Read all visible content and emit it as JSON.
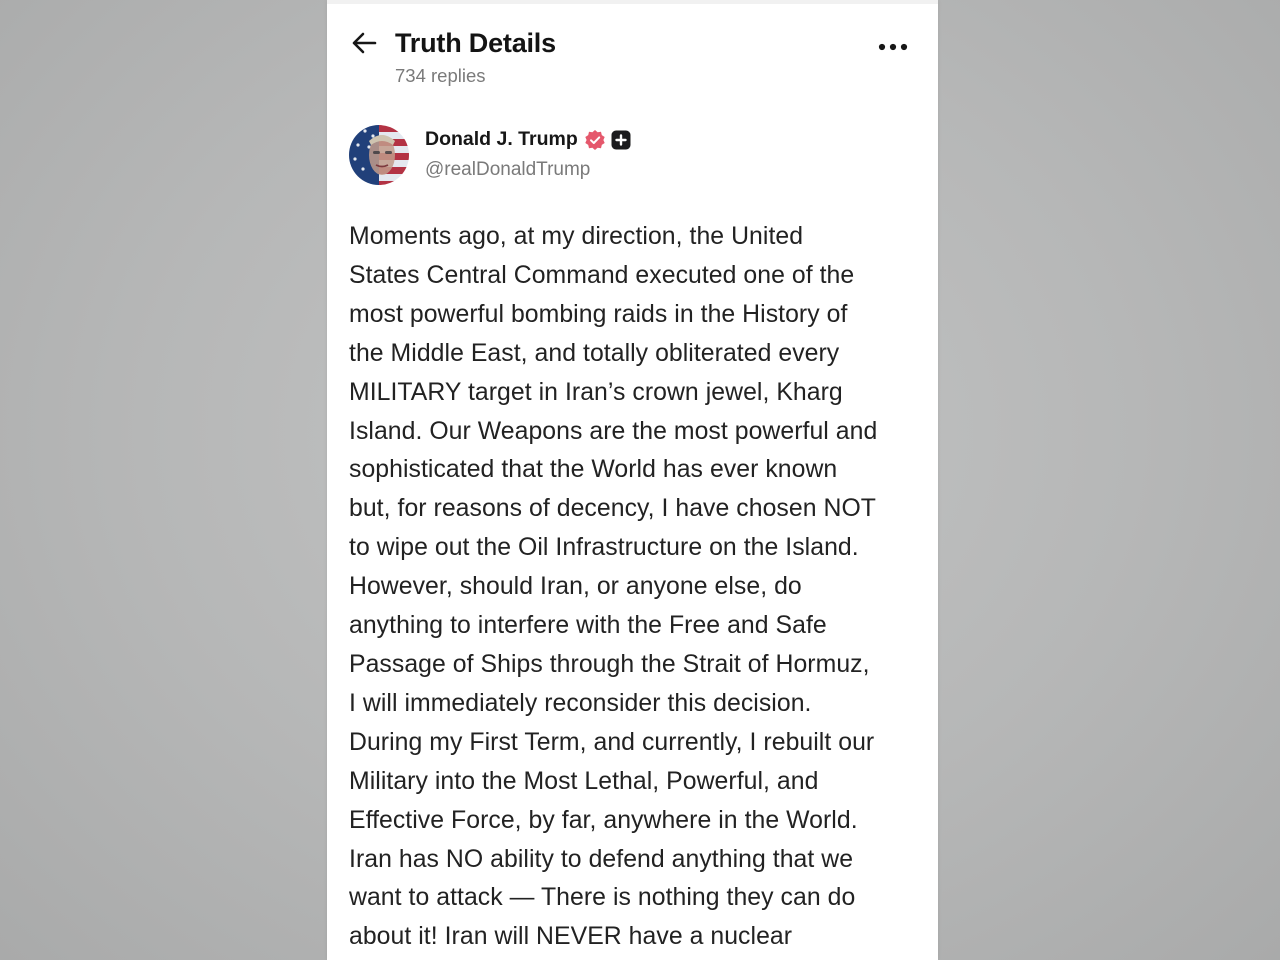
{
  "header": {
    "title": "Truth Details",
    "replies": "734 replies"
  },
  "author": {
    "name": "Donald J. Trump",
    "handle": "@realDonaldTrump",
    "avatar_icon": "flag-portrait-avatar",
    "verified_icon": "verified-badge-icon",
    "badge_icon": "plus-badge-icon",
    "verified_color": "#e5586c"
  },
  "post": {
    "lines": [
      "Moments ago, at my direction, the United",
      "States Central Command executed one of the",
      "most powerful bombing raids in the History of",
      "the Middle East, and totally obliterated every",
      "MILITARY target in Iran’s crown jewel, Kharg",
      "Island. Our Weapons are the most powerful and",
      "sophisticated that the World has ever known",
      "but, for reasons of decency, I have chosen NOT",
      "to wipe out the Oil Infrastructure on the Island.",
      "However, should Iran, or anyone else, do",
      "anything to interfere with the Free and Safe",
      "Passage of Ships through the Strait of Hormuz,",
      "I will immediately reconsider this decision.",
      "During my First Term, and currently, I rebuilt our",
      "Military into the Most Lethal, Powerful, and",
      "Effective Force, by far, anywhere in the World.",
      "Iran has NO ability to defend anything that we",
      "want to attack — There is nothing they can do",
      "about it! Iran will NEVER have a nuclear"
    ]
  },
  "icons": {
    "back": "arrow-left-icon",
    "more": "more-horizontal-icon"
  }
}
